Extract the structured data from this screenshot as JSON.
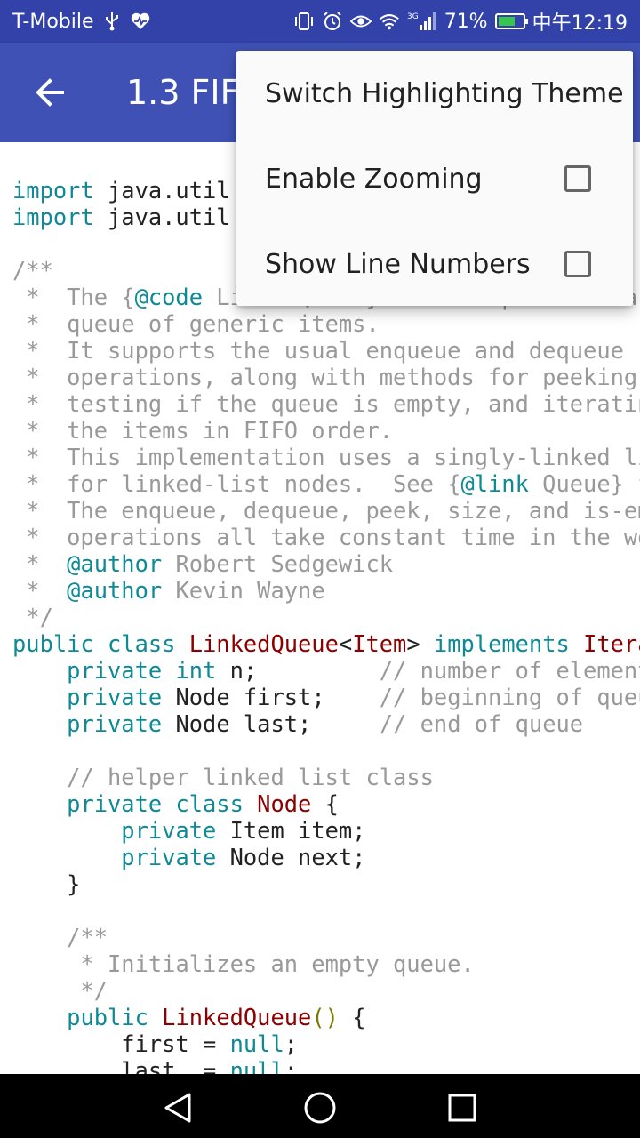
{
  "status_bar": {
    "carrier": "T-Mobile",
    "battery_percent": "71%",
    "battery_level": 0.71,
    "time": "中午12:19",
    "network": "3G"
  },
  "app_bar": {
    "title": "1.3 FIF"
  },
  "menu": {
    "items": [
      {
        "label": "Switch Highlighting Theme",
        "has_checkbox": false
      },
      {
        "label": "Enable Zooming",
        "has_checkbox": true,
        "checked": false
      },
      {
        "label": "Show Line Numbers",
        "has_checkbox": true,
        "checked": false
      }
    ]
  },
  "code_lines": [
    [
      [
        "kw",
        "import"
      ],
      [
        "pl",
        " java.util"
      ]
    ],
    [
      [
        "kw",
        "import"
      ],
      [
        "pl",
        " java.util"
      ]
    ],
    [],
    [
      [
        "cm",
        "/**"
      ]
    ],
    [
      [
        "cm",
        " *  The {"
      ],
      [
        "tag",
        "@code"
      ],
      [
        "cm",
        " LinkedQueue} class represents a first-in-first-out (FIFO)"
      ]
    ],
    [
      [
        "cm",
        " *  queue of generic items."
      ]
    ],
    [
      [
        "cm",
        " *  It supports the usual enqueue and dequeue"
      ]
    ],
    [
      [
        "cm",
        " *  operations, along with methods for peeking at the first item,"
      ]
    ],
    [
      [
        "cm",
        " *  testing if the queue is empty, and iterating through"
      ]
    ],
    [
      [
        "cm",
        " *  the items in FIFO order."
      ]
    ],
    [
      [
        "cm",
        " *  This implementation uses a singly-linked list with a non-static nested class"
      ]
    ],
    [
      [
        "cm",
        " *  for linked-list nodes.  See {"
      ],
      [
        "tag",
        "@link"
      ],
      [
        "cm",
        " Queue} for a version that uses a static nested class."
      ]
    ],
    [
      [
        "cm",
        " *  The enqueue, dequeue, peek, size, and is-empty"
      ]
    ],
    [
      [
        "cm",
        " *  operations all take constant time in the worst case."
      ]
    ],
    [
      [
        "cm",
        " *  "
      ],
      [
        "tag",
        "@author"
      ],
      [
        "cm",
        " Robert Sedgewick"
      ]
    ],
    [
      [
        "cm",
        " *  "
      ],
      [
        "tag",
        "@author"
      ],
      [
        "cm",
        " Kevin Wayne"
      ]
    ],
    [
      [
        "cm",
        " */"
      ]
    ],
    [
      [
        "kw",
        "public class "
      ],
      [
        "ty",
        "LinkedQueue"
      ],
      [
        "pl",
        "<"
      ],
      [
        "ty",
        "Item"
      ],
      [
        "pl",
        "> "
      ],
      [
        "kw",
        "implements "
      ],
      [
        "ty",
        "Iterable"
      ]
    ],
    [
      [
        "pl",
        "    "
      ],
      [
        "kw",
        "private int"
      ],
      [
        "pl",
        " n;         "
      ],
      [
        "cm",
        "// number of elements on queue"
      ]
    ],
    [
      [
        "pl",
        "    "
      ],
      [
        "kw",
        "private"
      ],
      [
        "pl",
        " Node first;    "
      ],
      [
        "cm",
        "// beginning of queue"
      ]
    ],
    [
      [
        "pl",
        "    "
      ],
      [
        "kw",
        "private"
      ],
      [
        "pl",
        " Node last;     "
      ],
      [
        "cm",
        "// end of queue"
      ]
    ],
    [],
    [
      [
        "pl",
        "    "
      ],
      [
        "cm",
        "// helper linked list class"
      ]
    ],
    [
      [
        "pl",
        "    "
      ],
      [
        "kw",
        "private class "
      ],
      [
        "ty",
        "Node"
      ],
      [
        "pl",
        " {"
      ]
    ],
    [
      [
        "pl",
        "        "
      ],
      [
        "kw",
        "private"
      ],
      [
        "pl",
        " Item item;"
      ]
    ],
    [
      [
        "pl",
        "        "
      ],
      [
        "kw",
        "private"
      ],
      [
        "pl",
        " Node next;"
      ]
    ],
    [
      [
        "pl",
        "    }"
      ]
    ],
    [],
    [
      [
        "pl",
        "    "
      ],
      [
        "cm",
        "/**"
      ]
    ],
    [
      [
        "pl",
        "     "
      ],
      [
        "cm",
        "* Initializes an empty queue."
      ]
    ],
    [
      [
        "pl",
        "     "
      ],
      [
        "cm",
        "*/"
      ]
    ],
    [
      [
        "pl",
        "    "
      ],
      [
        "kw",
        "public "
      ],
      [
        "ty",
        "LinkedQueue"
      ],
      [
        "pu",
        "()"
      ],
      [
        "pl",
        " {"
      ]
    ],
    [
      [
        "pl",
        "        first = "
      ],
      [
        "kw",
        "null"
      ],
      [
        "pl",
        ";"
      ]
    ],
    [
      [
        "pl",
        "        last  = "
      ],
      [
        "kw",
        "null"
      ],
      [
        "pl",
        ";"
      ]
    ]
  ]
}
